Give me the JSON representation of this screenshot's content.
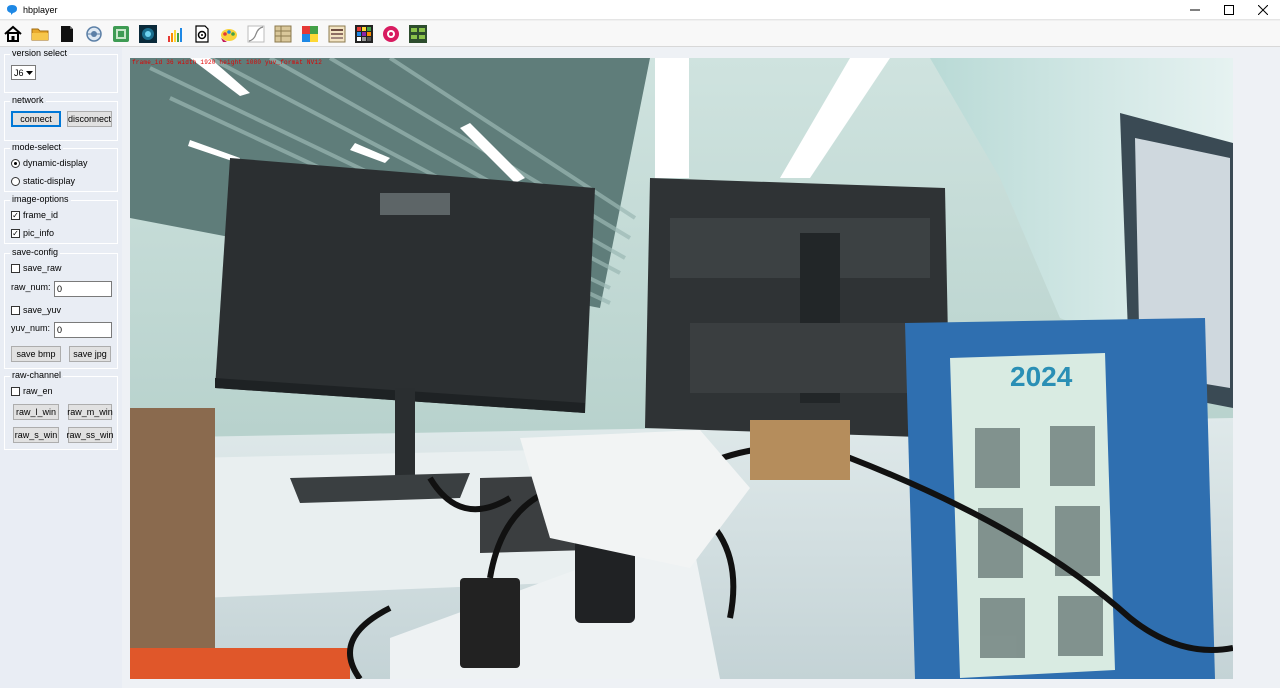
{
  "window": {
    "title": "hbplayer",
    "controls": [
      {
        "name": "minimize",
        "glyph": "—"
      },
      {
        "name": "maximize",
        "glyph": "☐"
      },
      {
        "name": "close",
        "glyph": "✕"
      }
    ]
  },
  "toolbar": {
    "buttons": [
      {
        "icon": "home-icon"
      },
      {
        "icon": "open-folder-icon"
      },
      {
        "icon": "black-file-icon"
      },
      {
        "icon": "pan-zoom-icon"
      },
      {
        "icon": "screen-capture-icon"
      },
      {
        "icon": "image-view-icon"
      },
      {
        "icon": "histogram-icon"
      },
      {
        "icon": "document-settings-icon"
      },
      {
        "icon": "color-palette-icon"
      },
      {
        "icon": "curve-icon"
      },
      {
        "icon": "grid-table-icon"
      },
      {
        "icon": "rgb-grid-icon"
      },
      {
        "icon": "bars-panel-icon"
      },
      {
        "icon": "color-checker-icon"
      },
      {
        "icon": "record-icon"
      },
      {
        "icon": "matrix-icon"
      }
    ]
  },
  "panel": {
    "version_select": {
      "title": "version select",
      "value": "J6"
    },
    "network": {
      "title": "network",
      "connect_label": "connect",
      "disconnect_label": "disconnect"
    },
    "mode_select": {
      "title": "mode-select",
      "options": [
        {
          "label": "dynamic-display",
          "checked": true
        },
        {
          "label": "static-display",
          "checked": false
        }
      ]
    },
    "image_options": {
      "title": "image-options",
      "items": [
        {
          "label": "frame_id",
          "checked": true
        },
        {
          "label": "pic_info",
          "checked": true
        }
      ]
    },
    "save_config": {
      "title": "save-config",
      "save_raw_label": "save_raw",
      "save_raw_checked": false,
      "raw_num_label": "raw_num:",
      "raw_num_value": "0",
      "save_yuv_label": "save_yuv",
      "save_yuv_checked": false,
      "yuv_num_label": "yuv_num:",
      "yuv_num_value": "0",
      "save_bmp_label": "save bmp",
      "save_jpg_label": "save jpg"
    },
    "raw_channel": {
      "title": "raw-channel",
      "raw_en_label": "raw_en",
      "raw_en_checked": false,
      "buttons": [
        "raw_l_win",
        "raw_m_win",
        "raw_s_win",
        "raw_ss_win"
      ]
    }
  },
  "display": {
    "overlay_text": "frame_id 36 width 1920 height 1080 yuv_format NV12"
  }
}
